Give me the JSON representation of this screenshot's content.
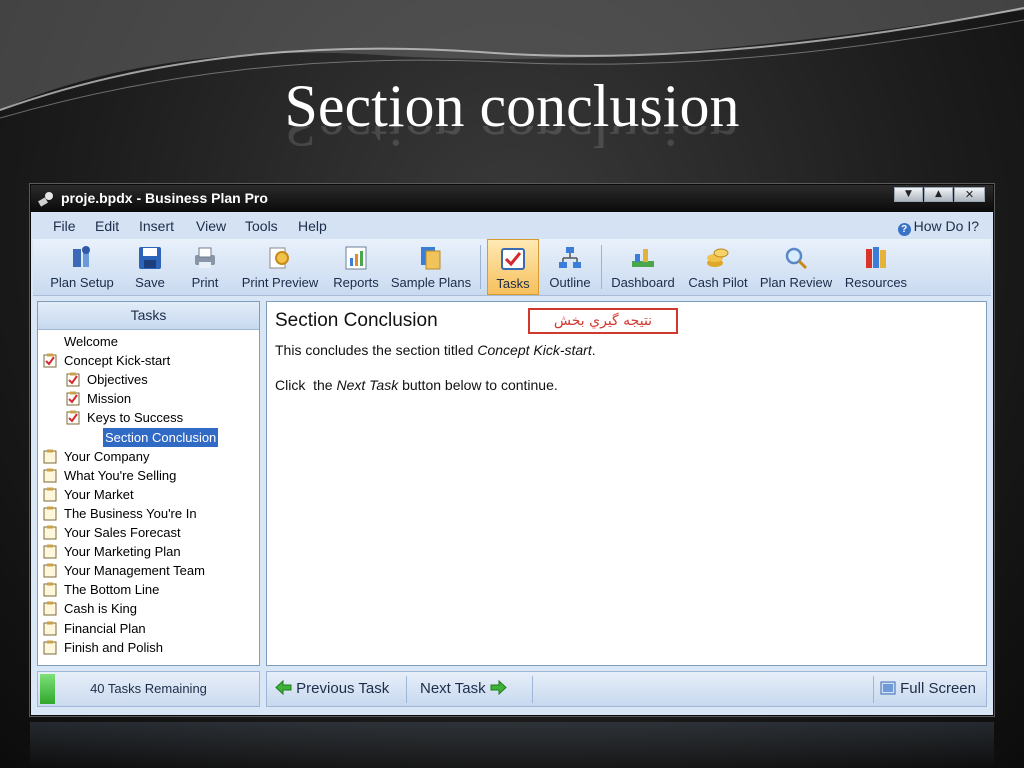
{
  "slide": {
    "title": "Section conclusion"
  },
  "window": {
    "title": "proje.bpdx - Business Plan Pro",
    "controls": [
      "minimize",
      "restore",
      "close"
    ]
  },
  "menu": {
    "items": [
      "File",
      "Edit",
      "Insert",
      "View",
      "Tools",
      "Help"
    ],
    "help_link": "How Do I?"
  },
  "toolbar": {
    "buttons": [
      {
        "label": "Plan Setup",
        "icon": "wrench-hammer-icon"
      },
      {
        "label": "Save",
        "icon": "floppy-disk-icon"
      },
      {
        "label": "Print",
        "icon": "printer-icon"
      },
      {
        "label": "Print Preview",
        "icon": "magnifier-document-icon"
      },
      {
        "label": "Reports",
        "icon": "bar-chart-document-icon"
      },
      {
        "label": "Sample Plans",
        "icon": "stacked-documents-icon"
      },
      {
        "label": "Tasks",
        "icon": "checkbox-icon",
        "active": true
      },
      {
        "label": "Outline",
        "icon": "org-chart-icon"
      },
      {
        "label": "Dashboard",
        "icon": "chart-dashboard-icon"
      },
      {
        "label": "Cash Pilot",
        "icon": "coins-icon"
      },
      {
        "label": "Plan Review",
        "icon": "magnifying-glass-icon"
      },
      {
        "label": "Resources",
        "icon": "books-icon"
      }
    ]
  },
  "tasks_panel": {
    "header": "Tasks",
    "items": [
      {
        "label": "Welcome",
        "level": 0,
        "icon": "none"
      },
      {
        "label": "Concept Kick-start",
        "level": 0,
        "icon": "checked-clipboard-icon"
      },
      {
        "label": "Objectives",
        "level": 1,
        "icon": "checked-clipboard-icon"
      },
      {
        "label": "Mission",
        "level": 1,
        "icon": "checked-clipboard-icon"
      },
      {
        "label": "Keys to Success",
        "level": 1,
        "icon": "checked-clipboard-icon"
      },
      {
        "label": "Section Conclusion",
        "level": 2,
        "icon": "none",
        "selected": true
      },
      {
        "label": "Your Company",
        "level": 0,
        "icon": "clipboard-icon"
      },
      {
        "label": "What You're Selling",
        "level": 0,
        "icon": "clipboard-icon"
      },
      {
        "label": "Your Market",
        "level": 0,
        "icon": "clipboard-icon"
      },
      {
        "label": "The Business You're In",
        "level": 0,
        "icon": "clipboard-icon"
      },
      {
        "label": "Your Sales Forecast",
        "level": 0,
        "icon": "clipboard-icon"
      },
      {
        "label": "Your Marketing Plan",
        "level": 0,
        "icon": "clipboard-icon"
      },
      {
        "label": "Your Management Team",
        "level": 0,
        "icon": "clipboard-icon"
      },
      {
        "label": "The Bottom Line",
        "level": 0,
        "icon": "clipboard-icon"
      },
      {
        "label": "Cash is King",
        "level": 0,
        "icon": "clipboard-icon"
      },
      {
        "label": "Financial Plan",
        "level": 0,
        "icon": "clipboard-icon"
      },
      {
        "label": "Finish and Polish",
        "level": 0,
        "icon": "clipboard-icon"
      }
    ]
  },
  "content": {
    "heading": "Section Conclusion",
    "annotation": "نتيجه گيري بخش",
    "line1_prefix": "This concludes the section titled",
    "line1_italic": "Concept Kick-start",
    "line1_suffix": ".",
    "line2_prefix": "Click  the",
    "line2_italic": "Next Task",
    "line2_suffix": "button below to continue."
  },
  "status": {
    "remaining": "40 Tasks Remaining",
    "progress_fraction": 0.07
  },
  "nav": {
    "previous": "Previous Task",
    "next": "Next Task",
    "full_screen": "Full Screen"
  },
  "colors": {
    "selection": "#316ac5",
    "annotation": "#d0382e",
    "progress": "#2fa82b",
    "active_button": "#f7c05c"
  }
}
